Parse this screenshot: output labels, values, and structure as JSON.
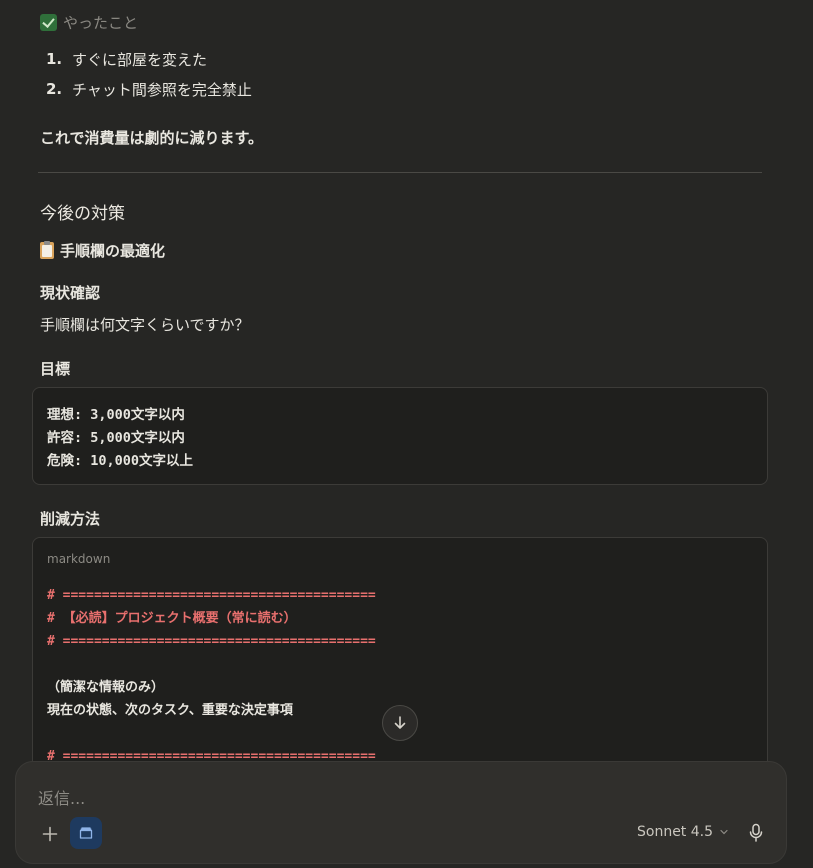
{
  "done_section": {
    "heading": "やったこと",
    "items": [
      {
        "num": "1.",
        "text": "すぐに部屋を変えた"
      },
      {
        "num": "2.",
        "text": "チャット間参照を完全禁止"
      }
    ],
    "conclusion": "これで消費量は劇的に減ります。"
  },
  "section_title": "今後の対策",
  "subsection_title": "手順欄の最適化",
  "status_check_label": "現状確認",
  "status_question": "手順欄は何文字くらいですか？",
  "goal_label": "目標",
  "goal_code": [
    "理想: 3,000文字以内",
    "許容: 5,000文字以内",
    "危険: 10,000文字以上"
  ],
  "reduction_label": "削減方法",
  "code_block": {
    "language": "markdown",
    "lines": [
      {
        "text": "# ========================================",
        "style": "red"
      },
      {
        "text": "# 【必読】プロジェクト概要（常に読む）",
        "style": "red"
      },
      {
        "text": "# ========================================",
        "style": "red"
      },
      {
        "text": "",
        "style": "white"
      },
      {
        "text": "（簡潔な情報のみ）",
        "style": "white"
      },
      {
        "text": "現在の状態、次のタスク、重要な決定事項",
        "style": "white"
      },
      {
        "text": "",
        "style": "white"
      },
      {
        "text": "# ========================================",
        "style": "red"
      }
    ]
  },
  "composer": {
    "placeholder": "返信...",
    "model": "Sonnet 4.5"
  },
  "icons": {
    "check": "check-box-icon",
    "clipboard": "clipboard-icon",
    "scroll": "arrow-down-icon",
    "plus": "plus-icon",
    "project": "folder-icon",
    "chevron": "chevron-down-icon",
    "mic": "microphone-icon"
  },
  "colors": {
    "background": "#262624",
    "code_red": "#e8706e",
    "accent_blue": "#1e3a5f"
  }
}
